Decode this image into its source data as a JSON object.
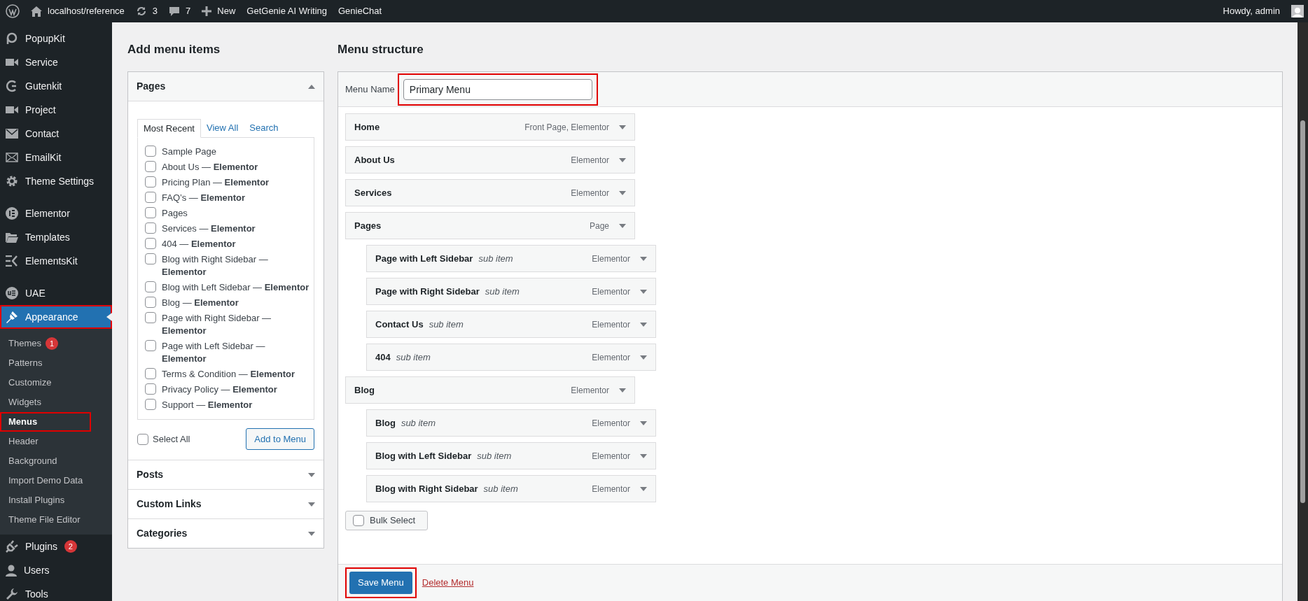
{
  "admin_bar": {
    "site": "localhost/reference",
    "updates": "3",
    "comments": "7",
    "new": "New",
    "links": [
      "GetGenie AI Writing",
      "GenieChat"
    ],
    "greeting": "Howdy, admin"
  },
  "sidebar": {
    "sections": [
      [
        {
          "label": "PopupKit"
        },
        {
          "label": "Service"
        },
        {
          "label": "Gutenkit"
        },
        {
          "label": "Project"
        },
        {
          "label": "Contact"
        },
        {
          "label": "EmailKit"
        },
        {
          "label": "Theme Settings"
        }
      ],
      [
        {
          "label": "Elementor"
        },
        {
          "label": "Templates"
        },
        {
          "label": "ElementsKit"
        }
      ],
      [
        {
          "label": "UAE"
        },
        {
          "label": "Appearance",
          "current": true,
          "highlighted": true,
          "submenu": [
            {
              "label": "Themes",
              "badge": "1",
              "selected": false,
              "highlighted": false
            },
            {
              "label": "Patterns",
              "selected": false,
              "highlighted": false
            },
            {
              "label": "Customize",
              "selected": false,
              "highlighted": false
            },
            {
              "label": "Widgets",
              "selected": false,
              "highlighted": false
            },
            {
              "label": "Menus",
              "selected": true,
              "highlighted": true
            },
            {
              "label": "Header",
              "selected": false,
              "highlighted": false
            },
            {
              "label": "Background",
              "selected": false,
              "highlighted": false
            },
            {
              "label": "Import Demo Data",
              "selected": false,
              "highlighted": false
            },
            {
              "label": "Install Plugins",
              "selected": false,
              "highlighted": false
            },
            {
              "label": "Theme File Editor",
              "selected": false,
              "highlighted": false
            }
          ]
        },
        {
          "label": "Plugins",
          "badge": "2"
        },
        {
          "label": "Users"
        },
        {
          "label": "Tools"
        }
      ]
    ]
  },
  "add_menu_items": {
    "title": "Add menu items",
    "panels": [
      {
        "title": "Pages",
        "expanded": true,
        "tabs": [
          {
            "label": "Most Recent",
            "selected": true
          },
          {
            "label": "View All",
            "selected": false
          },
          {
            "label": "Search",
            "selected": false
          }
        ],
        "items": [
          {
            "label": "Sample Page",
            "checked": false
          },
          {
            "label": "About Us — **Elementor**",
            "checked": false
          },
          {
            "label": "Pricing Plan — **Elementor**",
            "checked": false
          },
          {
            "label": "FAQ’s — **Elementor**",
            "checked": false
          },
          {
            "label": "Pages",
            "checked": false
          },
          {
            "label": "Services — **Elementor**",
            "checked": false
          },
          {
            "label": "404 — **Elementor**",
            "checked": false
          },
          {
            "label": "Blog with Right Sidebar — **Elementor**",
            "checked": false
          },
          {
            "label": "Blog with Left Sidebar — **Elementor**",
            "checked": false
          },
          {
            "label": "Blog — **Elementor**",
            "checked": false
          },
          {
            "label": "Page with Right Sidebar — **Elementor**",
            "checked": false
          },
          {
            "label": "Page with Left Sidebar — **Elementor**",
            "checked": false
          },
          {
            "label": "Terms & Condition — **Elementor**",
            "checked": false
          },
          {
            "label": "Privacy Policy — **Elementor**",
            "checked": false
          },
          {
            "label": "Support — **Elementor**",
            "checked": false
          }
        ],
        "select_all": {
          "label": "Select All",
          "checked": false
        },
        "button": "Add to Menu"
      },
      {
        "title": "Posts",
        "expanded": false
      },
      {
        "title": "Custom Links",
        "expanded": false
      },
      {
        "title": "Categories",
        "expanded": false
      }
    ]
  },
  "menu_structure": {
    "title": "Menu structure",
    "menu_name": {
      "label": "Menu Name",
      "value": "Primary Menu",
      "highlighted": true
    },
    "items": [
      {
        "title": "Home",
        "type": "Front Page, Elementor"
      },
      {
        "title": "About Us",
        "type": "Elementor"
      },
      {
        "title": "Services",
        "type": "Elementor"
      },
      {
        "title": "Pages",
        "type": "Page",
        "children": [
          {
            "title": "Page with Left Sidebar",
            "note": "sub item",
            "type": "Elementor"
          },
          {
            "title": "Page with Right Sidebar",
            "note": "sub item",
            "type": "Elementor"
          },
          {
            "title": "Contact Us",
            "note": "sub item",
            "type": "Elementor"
          },
          {
            "title": "404",
            "note": "sub item",
            "type": "Elementor"
          }
        ]
      },
      {
        "title": "Blog",
        "type": "Elementor",
        "children": [
          {
            "title": "Blog",
            "note": "sub item",
            "type": "Elementor"
          },
          {
            "title": "Blog with Left Sidebar",
            "note": "sub item",
            "type": "Elementor"
          },
          {
            "title": "Blog with Right Sidebar",
            "note": "sub item",
            "type": "Elementor"
          }
        ]
      }
    ],
    "bulk_select": {
      "label": "Bulk Select",
      "checked": false
    },
    "save_button": {
      "label": "Save Menu",
      "highlighted": true
    },
    "delete_link": "Delete Menu"
  }
}
